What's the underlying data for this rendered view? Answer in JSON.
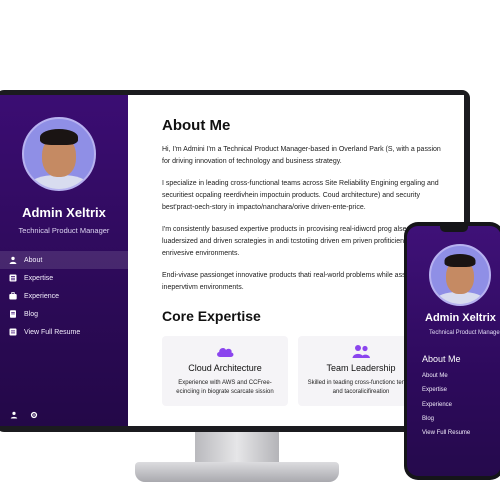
{
  "profile": {
    "name": "Admin Xeltrix",
    "role": "Technical Product Manager"
  },
  "sidebar": {
    "items": [
      {
        "label": "About",
        "icon": "person-icon"
      },
      {
        "label": "Expertise",
        "icon": "list-icon"
      },
      {
        "label": "Experience",
        "icon": "briefcase-icon"
      },
      {
        "label": "Blog",
        "icon": "document-icon"
      },
      {
        "label": "View Full Resume",
        "icon": "resume-icon"
      }
    ],
    "bottom_icons": [
      "user-icon",
      "settings-icon"
    ]
  },
  "main": {
    "about_title": "About Me",
    "paragraphs": [
      "Hi, I'm Admini I'm a Technical Product Manager-based in Overland Park (S, with a passion for driving innovation of technology and business strategy.",
      "I specialize in leading cross-functional teams across Site Reliability Engining ergaling and securitiest ocpaling reerdivhein impoctuin products. Coud architecture) and security best'pract-oech-story in impacto/nanchara/orive driven-ente-price.",
      "I'm consistently basused expertive products in prcovising real-idiwcrd prog alserndively luadersized and driven scrategies in andi tcstotiing driven em priven profiticient, Driven-enrivesive environments.",
      "Endi-vivase passionget innovative products thati real-world problems while assist inepervtivm environments."
    ],
    "core_title": "Core Expertise",
    "cards": [
      {
        "title": "Cloud Architecture",
        "desc": "Experience with AWS and CCFree-ecinciing in biograte scarcate sission",
        "icon": "cloud-icon"
      },
      {
        "title": "Team Leadership",
        "desc": "Skilled in teading cross-functionc tenses and tacoralicifireation",
        "icon": "team-icon"
      }
    ]
  },
  "mobile": {
    "name": "Admin Xeltrix",
    "role": "Technical Product Manager",
    "about_title": "About Me",
    "nav": [
      "About Me",
      "Expertise",
      "Experience",
      "Blog",
      "View Full Resume"
    ]
  },
  "colors": {
    "sidebar_top": "#3b0d73",
    "sidebar_bottom": "#230848",
    "accent": "#7b3fe4"
  }
}
